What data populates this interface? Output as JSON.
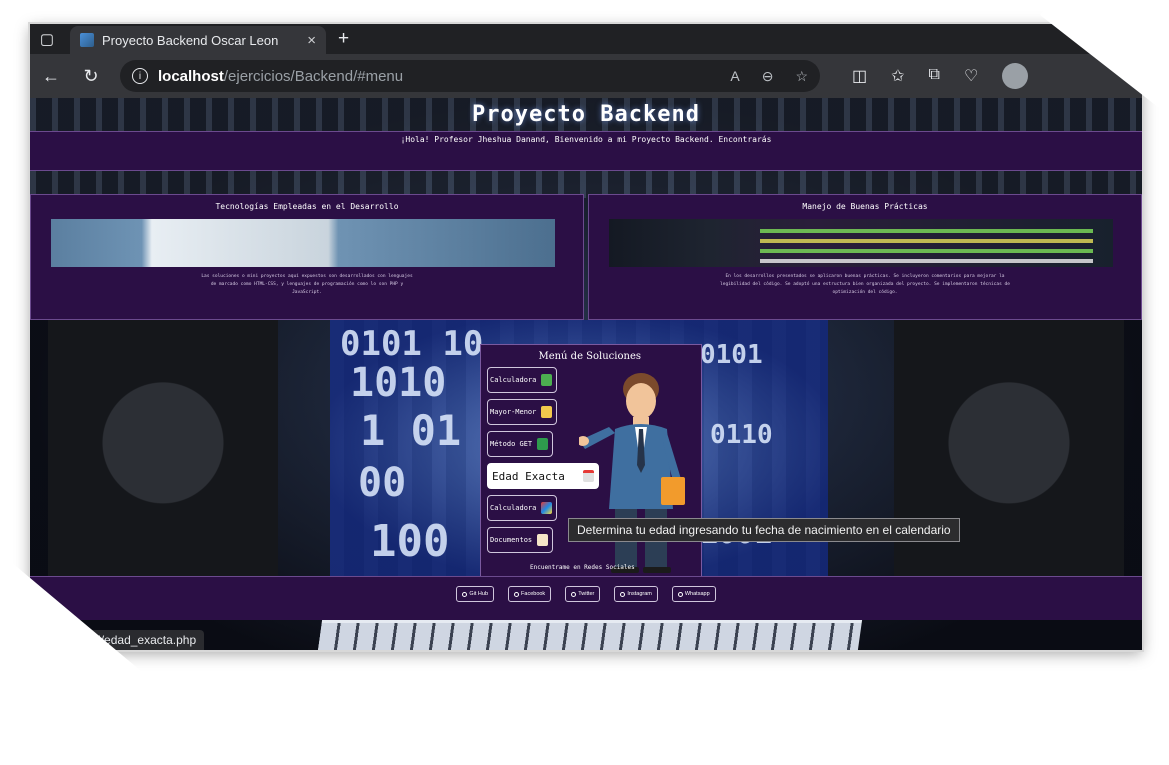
{
  "browser": {
    "tab_title": "Proyecto Backend Oscar Leon",
    "tab_close": "×",
    "new_tab": "+",
    "url_host": "localhost",
    "url_path": "/ejercicios/Backend/#menu",
    "status_url": "os/Backend/edad_exacta.php",
    "icons": [
      "back-icon",
      "reload-icon",
      "info-icon",
      "read-aloud-icon",
      "zoom-icon",
      "favorite-icon",
      "split-screen-icon",
      "favorites-icon",
      "collections-icon",
      "health-icon",
      "profile-icon"
    ]
  },
  "page": {
    "title": "Proyecto Backend",
    "welcome": "¡Hola! Profesor Jheshua Danand, Bienvenido a mi Proyecto Backend. Encontrarás",
    "cards": [
      {
        "title": "Tecnologías Empleadas en el Desarrollo",
        "desc": "Las soluciones o mini proyectos aquí expuestos son desarrollados con lenguajes de marcado como HTML-CSS, y lenguajes de programación como lo son PHP y JavaScript."
      },
      {
        "title": "Manejo de Buenas Prácticas",
        "desc": "En los desarrollos presentados se aplicaron buenas prácticas. Se incluyeron comentarios para mejorar la legibilidad del código. Se adoptó una estructura bien organizada del proyecto. Se implementaron técnicas de optimización del código."
      }
    ],
    "menu": {
      "title": "Menú de Soluciones",
      "items": [
        {
          "label": "Calculadora"
        },
        {
          "label": "Mayor-Menor"
        },
        {
          "label": "Método GET"
        },
        {
          "label": "Edad Exacta"
        },
        {
          "label": "Calculadora"
        },
        {
          "label": "Documentos"
        }
      ]
    },
    "tooltip": "Determina tu edad ingresando tu fecha de nacimiento en el calendario",
    "footer_note": "Encuentrame en Redes Sociales",
    "social": [
      {
        "label": "Git Hub"
      },
      {
        "label": "Facebook"
      },
      {
        "label": "Twitter"
      },
      {
        "label": "Instagram"
      },
      {
        "label": "Whatsapp"
      }
    ]
  },
  "colors": {
    "purple_band": "#2b0f45",
    "border_purple": "#6b4a8e",
    "chrome_dark": "#202124",
    "chrome_mid": "#35363a"
  }
}
